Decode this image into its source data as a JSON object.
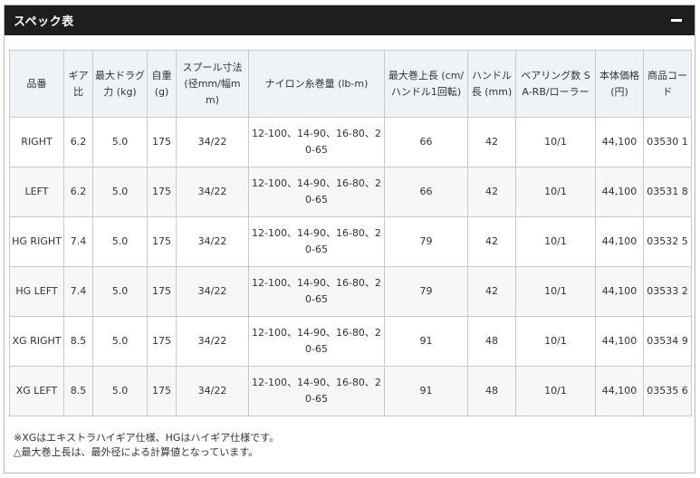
{
  "panel": {
    "title": "スペック表"
  },
  "table": {
    "headers": [
      "品番",
      "ギア比",
      "最大ドラグ力 (kg)",
      "自重 (g)",
      "スプール寸法 (径mm/幅mm)",
      "ナイロン糸巻量 (lb-m)",
      "最大巻上長 (cm/ハンドル1回転)",
      "ハンドル長 (mm)",
      "ベアリング数 S A-RB/ローラー",
      "本体価格 (円)",
      "商品コード"
    ],
    "rows": [
      [
        "RIGHT",
        "6.2",
        "5.0",
        "175",
        "34/22",
        "12-100、14-90、16-80、20-65",
        "66",
        "42",
        "10/1",
        "44,100",
        "03530 1"
      ],
      [
        "LEFT",
        "6.2",
        "5.0",
        "175",
        "34/22",
        "12-100、14-90、16-80、20-65",
        "66",
        "42",
        "10/1",
        "44,100",
        "03531 8"
      ],
      [
        "HG RIGHT",
        "7.4",
        "5.0",
        "175",
        "34/22",
        "12-100、14-90、16-80、20-65",
        "79",
        "42",
        "10/1",
        "44,100",
        "03532 5"
      ],
      [
        "HG LEFT",
        "7.4",
        "5.0",
        "175",
        "34/22",
        "12-100、14-90、16-80、20-65",
        "79",
        "42",
        "10/1",
        "44,100",
        "03533 2"
      ],
      [
        "XG RIGHT",
        "8.5",
        "5.0",
        "175",
        "34/22",
        "12-100、14-90、16-80、20-65",
        "91",
        "48",
        "10/1",
        "44,100",
        "03534 9"
      ],
      [
        "XG LEFT",
        "8.5",
        "5.0",
        "175",
        "34/22",
        "12-100、14-90、16-80、20-65",
        "91",
        "48",
        "10/1",
        "44,100",
        "03535 6"
      ]
    ]
  },
  "notes": [
    "※XGはエキストラハイギア仕様、HGはハイギア仕様です。",
    "△最大巻上長は、最外径による計算値となっています。"
  ],
  "icons": {
    "collapse": "minus-icon"
  },
  "colors": {
    "header_bar": "#1e1e1e",
    "table_head_bg": "#eef3f8",
    "row_alt_bg": "#f7f7f7",
    "border": "#c9c9c9"
  }
}
